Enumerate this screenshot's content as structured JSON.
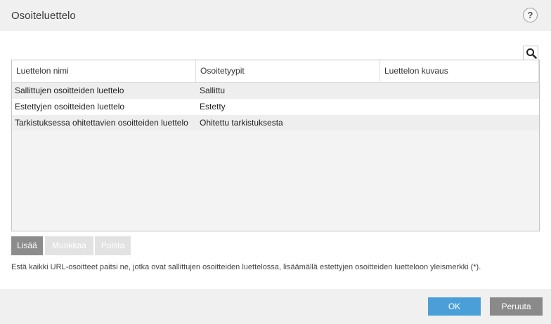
{
  "dialog": {
    "title": "Osoiteluettelo",
    "help_label": "?"
  },
  "table": {
    "columns": [
      "Luettelon nimi",
      "Osoitetyypit",
      "Luettelon kuvaus"
    ],
    "rows": [
      {
        "name": "Sallittujen osoitteiden luettelo",
        "type": "Sallittu",
        "description": ""
      },
      {
        "name": "Estettyjen osoitteiden luettelo",
        "type": "Estetty",
        "description": ""
      },
      {
        "name": "Tarkistuksessa ohitettavien osoitteiden luettelo",
        "type": "Ohitettu tarkistuksesta",
        "description": ""
      }
    ]
  },
  "actions": {
    "add_label": "Lisää",
    "edit_label": "Muokkaa",
    "delete_label": "Poista"
  },
  "info_text": "Estä kaikki URL-osoitteet paitsi ne, jotka ovat sallittujen osoitteiden luettelossa, lisäämällä estettyjen osoitteiden luetteloon yleismerkki (*).",
  "footer": {
    "ok_label": "OK",
    "cancel_label": "Peruuta"
  },
  "colors": {
    "ok_button": "#4a9fd8",
    "cancel_button": "#8a8a8a",
    "add_button": "#8c8c8c",
    "disabled_button": "#e2e2e2"
  },
  "icons": {
    "search": "search-icon",
    "help": "help-icon"
  }
}
